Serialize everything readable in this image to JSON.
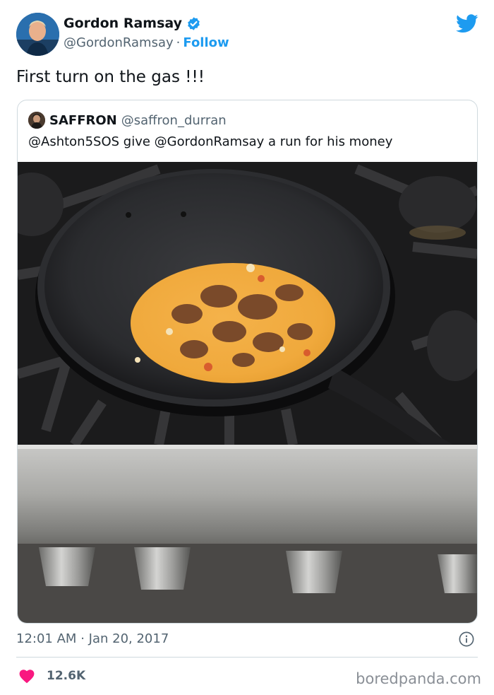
{
  "author": {
    "name": "Gordon Ramsay",
    "handle": "@GordonRamsay",
    "separator": "·",
    "follow_label": "Follow"
  },
  "tweet": {
    "text": "First turn on the gas !!!"
  },
  "quoted": {
    "name": "SAFFRON",
    "handle": "@saffron_durran",
    "text": "@Ashton5SOS give @GordonRamsay a run for his money"
  },
  "meta": {
    "time": "12:01 AM",
    "separator": "·",
    "date": "Jan 20, 2017"
  },
  "engagement": {
    "likes": "12.6K"
  },
  "watermark": "boredpanda.com",
  "colors": {
    "link_blue": "#1d9bf0",
    "heart_red": "#f91880",
    "muted_text": "#536471"
  },
  "icons": {
    "verified": "verified-badge-icon",
    "twitter": "twitter-bird-icon",
    "info": "info-icon",
    "heart": "heart-icon"
  }
}
